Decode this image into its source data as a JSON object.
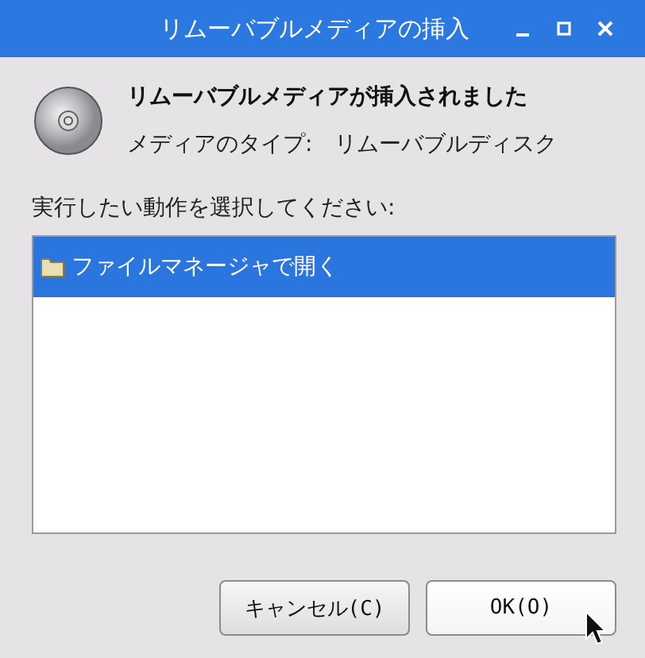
{
  "window": {
    "title": "リムーバブルメディアの挿入"
  },
  "heading": "リムーバブルメディアが挿入されました",
  "media_type": {
    "label": "メディアのタイプ:",
    "value": "リムーバブルディスク"
  },
  "prompt": "実行したい動作を選択してください:",
  "actions": [
    {
      "label": "ファイルマネージャで開く",
      "selected": true
    }
  ],
  "buttons": [
    {
      "label": "キャンセル(C)",
      "kind": "cancel"
    },
    {
      "label": "OK(O)",
      "kind": "ok"
    }
  ]
}
